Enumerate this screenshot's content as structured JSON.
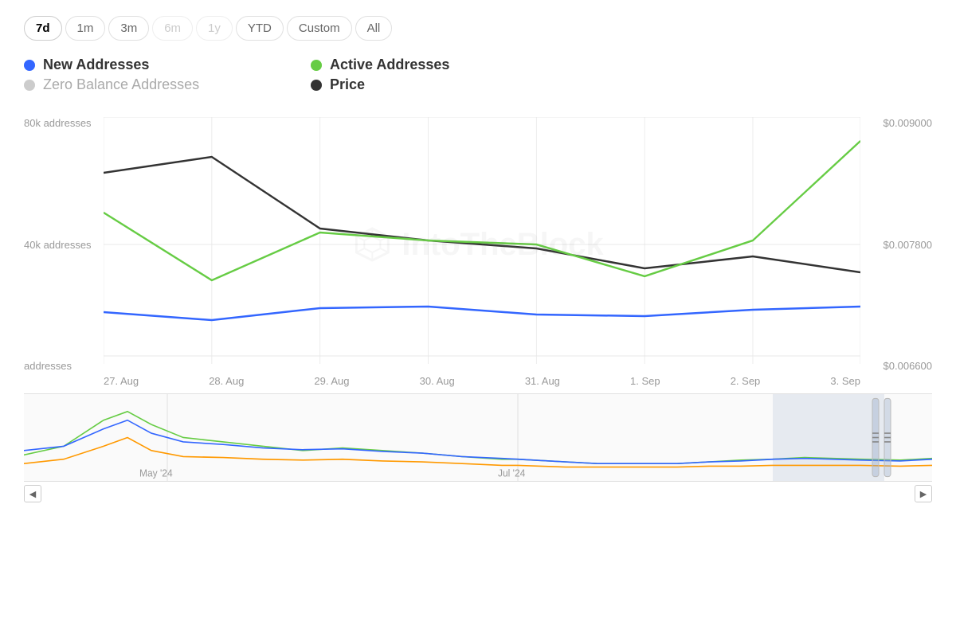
{
  "timeRange": {
    "buttons": [
      {
        "label": "7d",
        "active": true,
        "disabled": false
      },
      {
        "label": "1m",
        "active": false,
        "disabled": false
      },
      {
        "label": "3m",
        "active": false,
        "disabled": false
      },
      {
        "label": "6m",
        "active": false,
        "disabled": true
      },
      {
        "label": "1y",
        "active": false,
        "disabled": true
      },
      {
        "label": "YTD",
        "active": false,
        "disabled": false
      },
      {
        "label": "Custom",
        "active": false,
        "disabled": false
      },
      {
        "label": "All",
        "active": false,
        "disabled": false
      }
    ]
  },
  "legend": [
    {
      "label": "New Addresses",
      "color": "#3366ff",
      "muted": false
    },
    {
      "label": "Active Addresses",
      "color": "#66cc44",
      "muted": false
    },
    {
      "label": "Zero Balance Addresses",
      "color": "#cccccc",
      "muted": true
    },
    {
      "label": "Price",
      "color": "#333333",
      "muted": false
    }
  ],
  "yAxis": {
    "left": [
      "80k addresses",
      "40k addresses",
      "addresses"
    ],
    "right": [
      "$0.009000",
      "$0.007800",
      "$0.006600"
    ]
  },
  "xAxis": {
    "labels": [
      "27. Aug",
      "28. Aug",
      "29. Aug",
      "30. Aug",
      "31. Aug",
      "1. Sep",
      "2. Sep",
      "3. Sep"
    ]
  },
  "overviewLabels": [
    "May '24",
    "Jul '24"
  ],
  "scrollbar": {
    "leftArrow": "◀",
    "rightArrow": "▶"
  },
  "watermark": "IntoTheBlock"
}
